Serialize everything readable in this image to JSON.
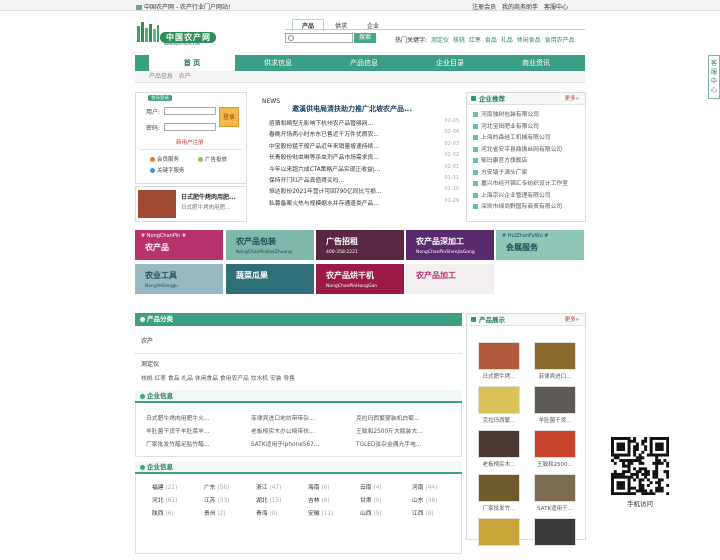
{
  "topbar": {
    "site_text": "中国农产网 - 农产行业门户网站!",
    "links": [
      "注册会员",
      "我的商务助手",
      "客服中心"
    ]
  },
  "logo": {
    "text": "中国农产网",
    "sub": "www.agricchina.com"
  },
  "search": {
    "tabs": [
      "产品",
      "供求",
      "企业"
    ],
    "active_tab": "产品",
    "button": "搜索",
    "hot_label": "热门关键字:",
    "hot_keywords": [
      "测定仪",
      "核桃",
      "红枣",
      "食品",
      "礼品",
      "休闲食品",
      "食用农产品"
    ]
  },
  "nav": {
    "items": [
      "首 页",
      "供求信息",
      "产品信息",
      "企业目录",
      "商业资讯"
    ],
    "active": "首 页"
  },
  "breadcrumb": "产品信息 · 农产",
  "login": {
    "badge": "会员登录",
    "user_label": "用户:",
    "pass_label": "密码:",
    "login_button": "登录",
    "register_link": "新用户注册",
    "services": [
      "会员服务",
      "广告投放",
      "关键字服务"
    ]
  },
  "ad_small": {
    "title": "日式肥牛烤肉用肥...",
    "desc": "日式肥牛烤肉用肥..."
  },
  "news": {
    "tag": "NEWS",
    "headline": "邀溪供电局清扶助力推广北坡农产品...",
    "items": [
      {
        "title": "痘猜和畸型无影响下杭州农产品管够网...",
        "date": "02-05"
      },
      {
        "title": "春晚开场两小时东东已售近千万件优质农...",
        "date": "02-04"
      },
      {
        "title": "中宝股份猛干般产品近年来销量增速持续...",
        "date": "02-03"
      },
      {
        "title": "长青股份吡虫啉等杀虫剂产品市场需求良...",
        "date": "02-02"
      },
      {
        "title": "今年以来超六成CTA策略产品实现正收益|...",
        "date": "02-01"
      },
      {
        "title": "保持开门红产品真值得买吗...",
        "date": "01-31"
      },
      {
        "title": "恒达股份2021年营计可回790亿同比亏损...",
        "date": "01-30"
      },
      {
        "title": "私募备案火热与规模缩水并存通道类产品...",
        "date": "01-29"
      }
    ]
  },
  "recommend": {
    "title": "企业推荐",
    "more": "更多»",
    "items": [
      "河南独树包装有限公司",
      "河北宝田肥业有限公司",
      "上海的森硅工机械有限公司",
      "河北省安平县鼎振丝网有限公司",
      "郁玛康官方旗舰店",
      "方安镇子源头厂家",
      "嘉兴市经开锦汇专纺织设计工作室",
      "上海京兴企业管理有限公司",
      "深圳市绿尚野国际商贸有限公司"
    ]
  },
  "tiles": [
    {
      "tag": "# NongChanPin #",
      "title": "农产品",
      "sub": "",
      "bg": "#b5336a"
    },
    {
      "tag": "",
      "title": "农产品包装",
      "sub": "NongChanPinBaoZhuang",
      "bg": "#7db8a8"
    },
    {
      "tag": "",
      "title": "广告招租",
      "sub": "400-358-2221",
      "bg": "#5a2740"
    },
    {
      "tag": "",
      "title": "农产品深加工",
      "sub": "NongChanPinShenJiaGong",
      "bg": "#5a2a6f"
    },
    {
      "tag": "# HuiZhanFuWu #",
      "title": "会展服务",
      "sub": "",
      "bg": "#8ec6b8"
    },
    {
      "tag": "",
      "title": "农业工具",
      "sub": "NongYeGongJu",
      "bg": "#9ab8c2"
    },
    {
      "tag": "",
      "title": "蔬菜瓜果",
      "sub": "",
      "bg": "#2f6f78"
    },
    {
      "tag": "",
      "title": "农产品烘干机",
      "sub": "NongChanPinHongGan",
      "bg": "#9b1a47"
    },
    {
      "tag": "",
      "title": "农产品加工",
      "sub": "",
      "bg": "#f3eef0"
    }
  ],
  "product_category": {
    "title": "产品分类",
    "top": "农产",
    "sub_title": "测定仪",
    "links": [
      "核桃",
      "红枣",
      "食品",
      "礼品",
      "休闲食品",
      "食用农产品",
      "饮水机",
      "安装",
      "导售"
    ]
  },
  "company_info": {
    "title": "企业信息",
    "items": [
      "日式肥牛烤肉用肥牛火...",
      "菲律宾进口地坊带带杂...",
      "克拉玛西繁婴装机白菊...",
      "羊肚菌干货干羊肚菜羊...",
      "老板椅实木办公椅带扶...",
      "王致和2500斤大瓶装大...",
      "厂家批发竹醋足贴竹醋...",
      "SATK适用于iphone567...",
      "TGLED弦杂金偶光手电..."
    ]
  },
  "enterprise": {
    "title": "企业信息",
    "regions": [
      {
        "name": "福建",
        "count": "(21)"
      },
      {
        "name": "广东",
        "count": "(56)"
      },
      {
        "name": "浙江",
        "count": "(47)"
      },
      {
        "name": "海南",
        "count": "(0)"
      },
      {
        "name": "云南",
        "count": "(4)"
      },
      {
        "name": "河南",
        "count": "(44)"
      },
      {
        "name": "河北",
        "count": "(61)"
      },
      {
        "name": "江苏",
        "count": "(33)"
      },
      {
        "name": "湖北",
        "count": "(15)"
      },
      {
        "name": "吉林",
        "count": "(6)"
      },
      {
        "name": "甘肃",
        "count": "(0)"
      },
      {
        "name": "山东",
        "count": "(38)"
      },
      {
        "name": "陕西",
        "count": "(6)"
      },
      {
        "name": "贵州",
        "count": "(2)"
      },
      {
        "name": "青海",
        "count": "(0)"
      },
      {
        "name": "安徽",
        "count": "(11)"
      },
      {
        "name": "山西",
        "count": "(5)"
      },
      {
        "name": "江西",
        "count": "(9)"
      }
    ]
  },
  "product_show": {
    "title": "产品展示",
    "more": "更多»",
    "items": [
      {
        "cap": "日式肥牛烤...",
        "color": "#b45a3c"
      },
      {
        "cap": "菲律宾进口...",
        "color": "#8a6b2c"
      },
      {
        "cap": "克拉玛西繁...",
        "color": "#d9c257"
      },
      {
        "cap": "羊肚菌干货...",
        "color": "#5d5a56"
      },
      {
        "cap": "老板椅实木...",
        "color": "#4b3a33"
      },
      {
        "cap": "王致和2500...",
        "color": "#c8432e"
      },
      {
        "cap": "厂家批发竹...",
        "color": "#6f5a2c"
      },
      {
        "cap": "SATK适用于...",
        "color": "#7d6d55"
      },
      {
        "cap": "",
        "color": "#caa63a"
      },
      {
        "cap": "",
        "color": "#3a3a3a"
      }
    ]
  },
  "side_tab": "客服中心",
  "qr_caption": "手机访问"
}
